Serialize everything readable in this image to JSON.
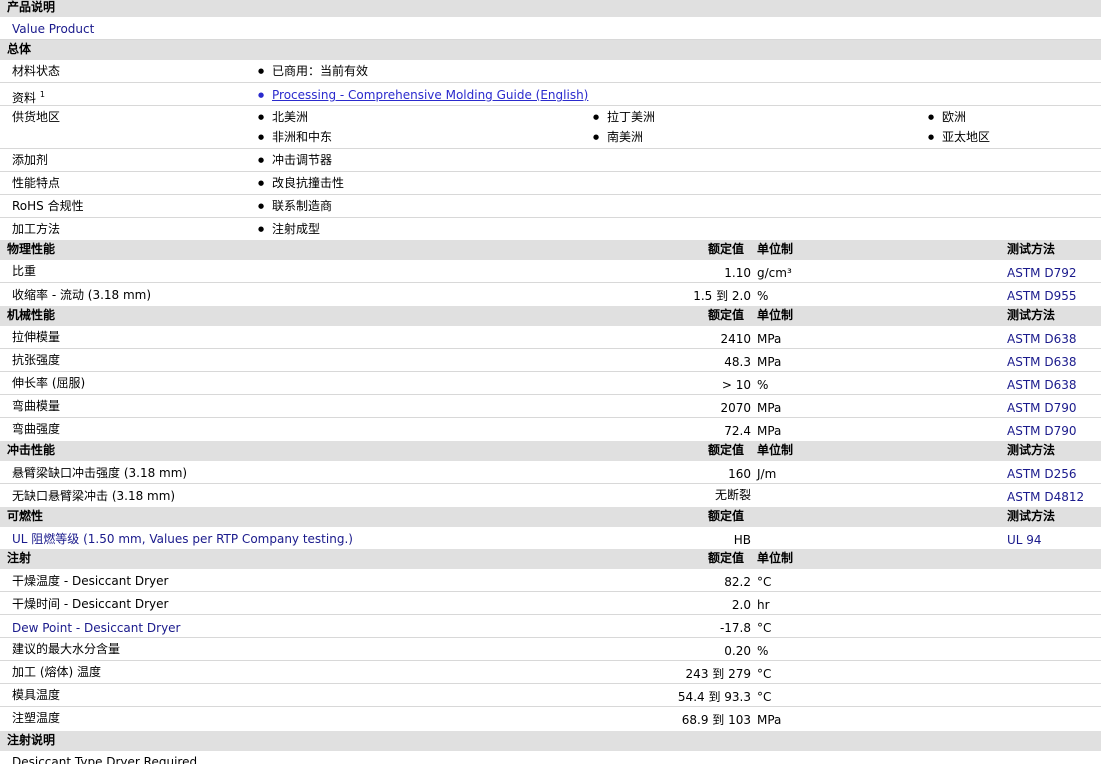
{
  "product": {
    "section": "产品说明",
    "value": "Value Product"
  },
  "general": {
    "section": "总体",
    "material_status": {
      "label": "材料状态",
      "value": "已商用：当前有效"
    },
    "data_sheet": {
      "label": "资料",
      "sup": "1",
      "link": "Processing - Comprehensive Molding Guide (English)"
    },
    "supply": {
      "label": "供货地区",
      "regions": [
        "北美洲",
        "拉丁美洲",
        "欧洲",
        "非洲和中东",
        "南美洲",
        "亚太地区"
      ]
    },
    "additive": {
      "label": "添加剂",
      "value": "冲击调节器"
    },
    "features": {
      "label": "性能特点",
      "value": "改良抗撞击性"
    },
    "rohs": {
      "label": "RoHS 合规性",
      "value": "联系制造商"
    },
    "processing": {
      "label": "加工方法",
      "value": "注射成型"
    }
  },
  "headers": {
    "nominal": "额定值",
    "unit": "单位制",
    "method": "测试方法"
  },
  "physical": {
    "section": "物理性能",
    "rows": [
      {
        "label": "比重",
        "value": "1.10",
        "unit": "g/cm³",
        "method": "ASTM D792"
      },
      {
        "label": "收缩率 - 流动 (3.18 mm)",
        "value": "1.5 到 2.0",
        "unit": "%",
        "method": "ASTM D955"
      }
    ]
  },
  "mechanical": {
    "section": "机械性能",
    "rows": [
      {
        "label": "拉伸模量",
        "value": "2410",
        "unit": "MPa",
        "method": "ASTM D638"
      },
      {
        "label": "抗张强度",
        "value": "48.3",
        "unit": "MPa",
        "method": "ASTM D638"
      },
      {
        "label": "伸长率 (屈服)",
        "value": "> 10",
        "unit": "%",
        "method": "ASTM D638"
      },
      {
        "label": "弯曲模量",
        "value": "2070",
        "unit": "MPa",
        "method": "ASTM D790"
      },
      {
        "label": "弯曲强度",
        "value": "72.4",
        "unit": "MPa",
        "method": "ASTM D790"
      }
    ]
  },
  "impact": {
    "section": "冲击性能",
    "rows": [
      {
        "label": "悬臂梁缺口冲击强度 (3.18 mm)",
        "value": "160",
        "unit": "J/m",
        "method": "ASTM D256"
      },
      {
        "label": "无缺口悬臂梁冲击 (3.18 mm)",
        "value": "无断裂",
        "unit": "",
        "method": "ASTM D4812"
      }
    ]
  },
  "flammability": {
    "section": "可燃性",
    "rows": [
      {
        "label": "UL 阻燃等级 (1.50 mm, Values per RTP Company testing.)",
        "value": "HB",
        "unit": "",
        "method": "UL 94"
      }
    ]
  },
  "injection": {
    "section": "注射",
    "rows": [
      {
        "label": "干燥温度 - Desiccant Dryer",
        "value": "82.2",
        "unit": "°C"
      },
      {
        "label": "干燥时间 - Desiccant Dryer",
        "value": "2.0",
        "unit": "hr"
      },
      {
        "label": "Dew Point - Desiccant Dryer",
        "value": "-17.8",
        "unit": "°C"
      },
      {
        "label": "建议的最大水分含量",
        "value": "0.20",
        "unit": "%"
      },
      {
        "label": "加工 (熔体) 温度",
        "value": "243 到 279",
        "unit": "°C"
      },
      {
        "label": "模具温度",
        "value": "54.4 到 93.3",
        "unit": "°C"
      },
      {
        "label": "注塑温度",
        "value": "68.9 到 103",
        "unit": "MPa"
      }
    ]
  },
  "injection_notes": {
    "section": "注射说明",
    "value": "Desiccant Type Dryer Required"
  }
}
